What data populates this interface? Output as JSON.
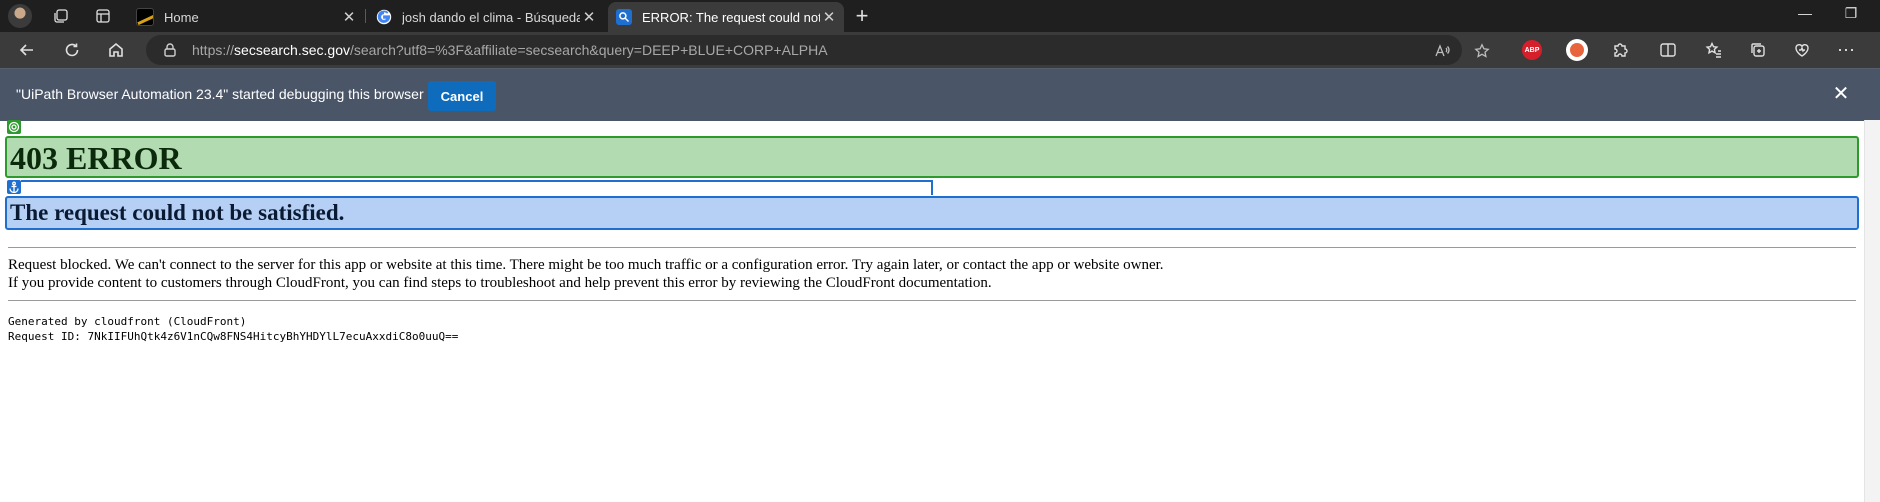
{
  "tabs": [
    {
      "title": "Home",
      "active": false
    },
    {
      "title": "josh dando el clima - Búsqueda de Google",
      "active": false
    },
    {
      "title": "ERROR: The request could not be satisfied",
      "active": true
    }
  ],
  "address_bar": {
    "url_scheme": "https://",
    "url_host": "secsearch.sec.gov",
    "url_path": "/search?utf8=%3F&affiliate=secsearch&query=DEEP+BLUE+CORP+ALPHA"
  },
  "infobar": {
    "message": "\"UiPath Browser Automation 23.4\" started debugging this browser",
    "cancel_label": "Cancel",
    "close_glyph": "✕"
  },
  "extensions": {
    "abp_label": "ABP"
  },
  "page": {
    "heading": "403 ERROR",
    "subheading": "The request could not be satisfied.",
    "paragraph1": "Request blocked. We can't connect to the server for this app or website at this time. There might be too much traffic or a configuration error. Try again later, or contact the app or website owner.",
    "paragraph2": "If you provide content to customers through CloudFront, you can find steps to troubleshoot and help prevent this error by reviewing the CloudFront documentation.",
    "generated_by": "Generated by cloudfront (CloudFront)",
    "request_id": "Request ID: 7NkIIFUhQtk4z6V1nCQw8FNS4HitcyBhYHDYlL7ecuAxxdiC8o0uuQ=="
  },
  "colors": {
    "uipath_green": "#2e9a2e",
    "uipath_blue": "#1f6fd1",
    "cancel_button": "#0f6cbd"
  }
}
